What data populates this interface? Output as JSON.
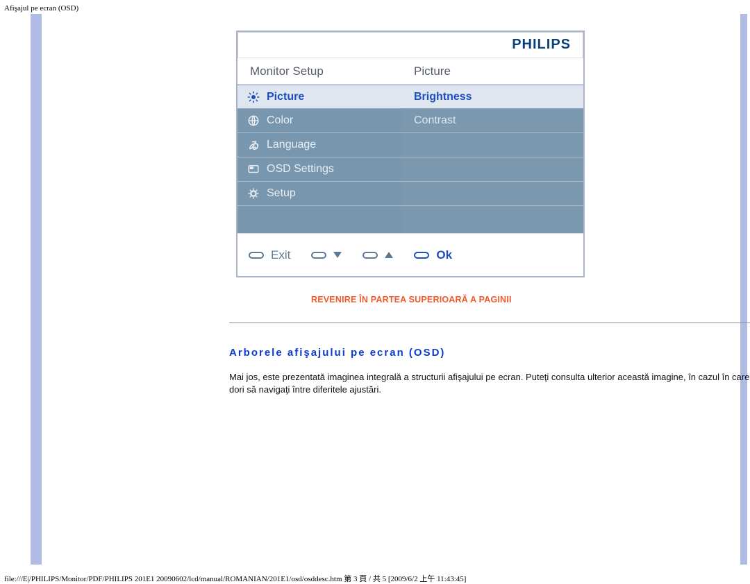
{
  "page": {
    "top_label": "Afişajul pe ecran (OSD)",
    "return_link": "REVENIRE ÎN PARTEA SUPERIOARĂ A PAGINII",
    "section_title": "Arborele afişajului pe ecran (OSD)",
    "body_text": "Mai jos, este prezentată imaginea integrală a structurii afişajului pe ecran. Puteţi consulta ulterior această imagine, în cazul în care veţi dori să navigaţi între diferitele ajustări.",
    "footer_line": "file:///E|/PHILIPS/Monitor/PDF/PHILIPS 201E1 20090602/lcd/manual/ROMANIAN/201E1/osd/osddesc.htm 第 3 頁 / 共 5  [2009/6/2 上午 11:43:45]"
  },
  "osd": {
    "brand": "PHILIPS",
    "left_title": "Monitor Setup",
    "right_title": "Picture",
    "left_items": [
      {
        "icon": "sun-icon",
        "label": "Picture",
        "selected": true
      },
      {
        "icon": "globe-icon",
        "label": "Color",
        "selected": false
      },
      {
        "icon": "language-icon",
        "label": "Language",
        "selected": false
      },
      {
        "icon": "osd-icon",
        "label": "OSD Settings",
        "selected": false
      },
      {
        "icon": "gear-icon",
        "label": "Setup",
        "selected": false
      }
    ],
    "right_items": [
      {
        "label": "Brightness",
        "selected": true
      },
      {
        "label": "Contrast",
        "selected": false
      }
    ],
    "footer": {
      "exit": "Exit",
      "ok": "Ok"
    }
  }
}
